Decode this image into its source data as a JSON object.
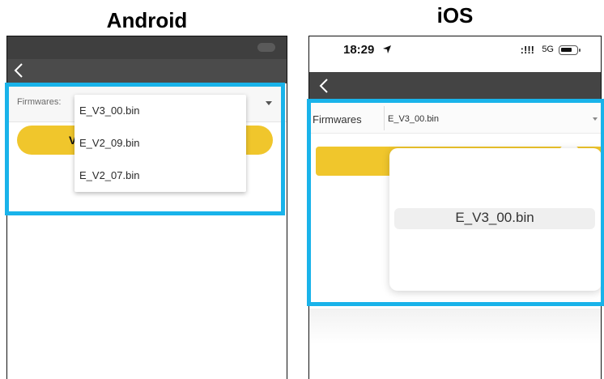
{
  "headings": {
    "android": "Android",
    "ios": "iOS"
  },
  "colors": {
    "highlight": "#19b3ea",
    "button_yellow": "#f0c62c",
    "nav_dark": "#444444"
  },
  "android": {
    "back_icon": "chevron-left-icon",
    "form": {
      "label": "Firmwares:"
    },
    "button_label": "V",
    "dropdown": {
      "options": [
        "E_V3_00.bin",
        "E_V2_09.bin",
        "E_V2_07.bin"
      ]
    }
  },
  "ios": {
    "status": {
      "time": "18:29",
      "signal": ":!!!",
      "network": "5G"
    },
    "back_icon": "chevron-left-icon",
    "form": {
      "label": "Firmwares",
      "value": "E_V3_00.bin"
    },
    "picker": {
      "selected": "E_V3_00.bin"
    }
  }
}
